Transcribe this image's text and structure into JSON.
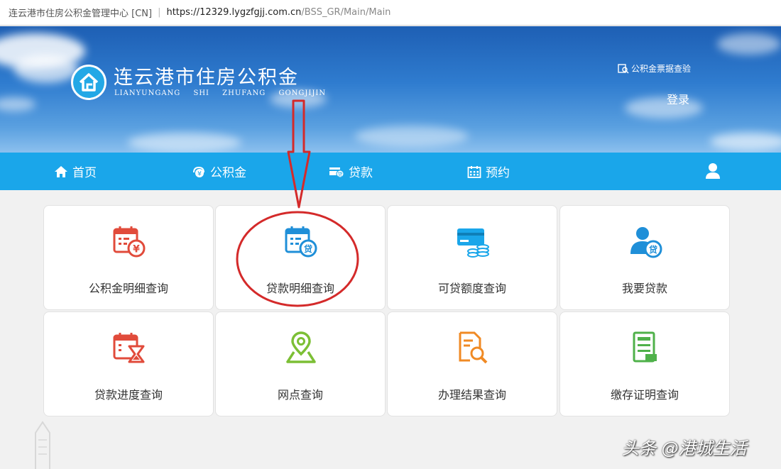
{
  "browser": {
    "site_title": "连云港市住房公积金管理中心 [CN]",
    "url_host": "https://12329.lygzfgjj.com.cn",
    "url_path": "/BSS_GR/Main/Main"
  },
  "header": {
    "logo_title": "连云港市住房公积金",
    "logo_subtitle": "LIANYUNGANG SHI ZHUFANG GONGJIJIN",
    "verify_link": "公积金票据查验",
    "login_link": "登录"
  },
  "nav": {
    "items": [
      {
        "label": "首页",
        "icon": "home-icon"
      },
      {
        "label": "公积金",
        "icon": "fund-icon"
      },
      {
        "label": "贷款",
        "icon": "loan-card-icon"
      },
      {
        "label": "预约",
        "icon": "calendar-icon"
      }
    ],
    "user_icon": "user-icon"
  },
  "tiles": [
    {
      "label": "公积金明细查询",
      "icon": "fund-detail-icon",
      "color": "#e14b3b"
    },
    {
      "label": "贷款明细查询",
      "icon": "loan-detail-icon",
      "color": "#1f8fd8"
    },
    {
      "label": "可贷额度查询",
      "icon": "loan-limit-icon",
      "color": "#1aa6ea"
    },
    {
      "label": "我要贷款",
      "icon": "apply-loan-icon",
      "color": "#1f8fd8"
    },
    {
      "label": "贷款进度查询",
      "icon": "loan-progress-icon",
      "color": "#e14b3b"
    },
    {
      "label": "网点查询",
      "icon": "location-icon",
      "color": "#7cbf35"
    },
    {
      "label": "办理结果查询",
      "icon": "result-search-icon",
      "color": "#f08a24"
    },
    {
      "label": "缴存证明查询",
      "icon": "deposit-cert-icon",
      "color": "#4fb14a"
    }
  ],
  "watermark": "头条 @港城生活",
  "colors": {
    "nav_bg": "#1aa6ea",
    "annotation": "#d42a2a"
  }
}
